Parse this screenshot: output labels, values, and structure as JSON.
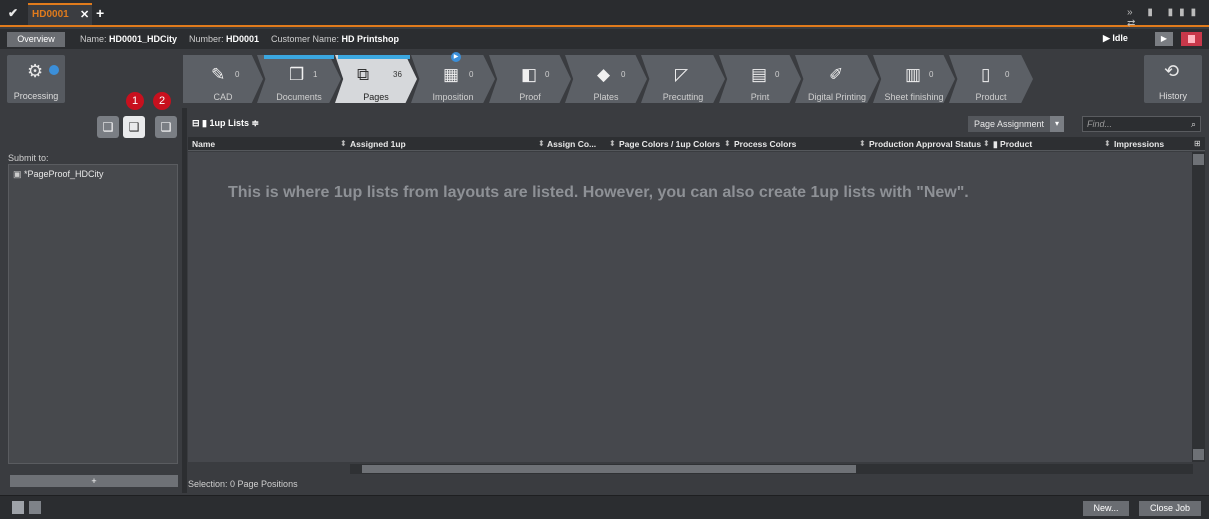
{
  "tabbar": {
    "job_tab": "HD0001",
    "close_glyph": "✕",
    "new_tab_glyph": "+",
    "right_icons": "» ▮ ▮▮▮ ⇄"
  },
  "infobar": {
    "overview": "Overview",
    "name_label": "Name:",
    "name_value": "HD0001_HDCity",
    "number_label": "Number:",
    "number_value": "HD0001",
    "customer_label": "Customer Name:",
    "customer_value": "HD Printshop",
    "status": "▶ Idle",
    "play": "▶"
  },
  "workflow": {
    "processing": "Processing",
    "history": "History",
    "steps": [
      {
        "label": "CAD",
        "count": "0",
        "icon": "cad-icon"
      },
      {
        "label": "Documents",
        "count": "1",
        "icon": "documents-icon"
      },
      {
        "label": "Pages",
        "count": "36",
        "icon": "pages-icon"
      },
      {
        "label": "Imposition",
        "count": "0",
        "icon": "imposition-icon"
      },
      {
        "label": "Proof",
        "count": "0",
        "icon": "proof-icon"
      },
      {
        "label": "Plates",
        "count": "0",
        "icon": "plates-icon"
      },
      {
        "label": "Precutting",
        "count": "",
        "icon": "precutting-icon"
      },
      {
        "label": "Print",
        "count": "0",
        "icon": "print-icon"
      },
      {
        "label": "Digital Printing",
        "count": "",
        "icon": "digital-printing-icon"
      },
      {
        "label": "Sheet finishing",
        "count": "0",
        "icon": "sheet-finishing-icon"
      },
      {
        "label": "Product",
        "count": "0",
        "icon": "product-icon"
      }
    ]
  },
  "left": {
    "badges": [
      "1",
      "2"
    ],
    "submit_label": "Submit to:",
    "submit_items": [
      "*PageProof_HDCity"
    ],
    "add": "+"
  },
  "main": {
    "list_type": "1up Lists ≑",
    "page_assignment": "Page Assignment",
    "find_placeholder": "Find...",
    "columns": [
      "Name",
      "Assigned 1up",
      "Assign Co...",
      "Page Colors / 1up Colors",
      "Process Colors",
      "Production Approval Status",
      "Product",
      "Impressions"
    ],
    "empty_message": "This is where 1up lists from layouts are listed. However, you can also create 1up lists with \"New\".",
    "selection": "Selection:  0 Page Positions"
  },
  "bottom": {
    "new": "New...",
    "close_job": "Close Job"
  },
  "colors": {
    "accent": "#e07b1c",
    "active_step_bar": "#3ba7e0",
    "badge": "#c8101e"
  }
}
